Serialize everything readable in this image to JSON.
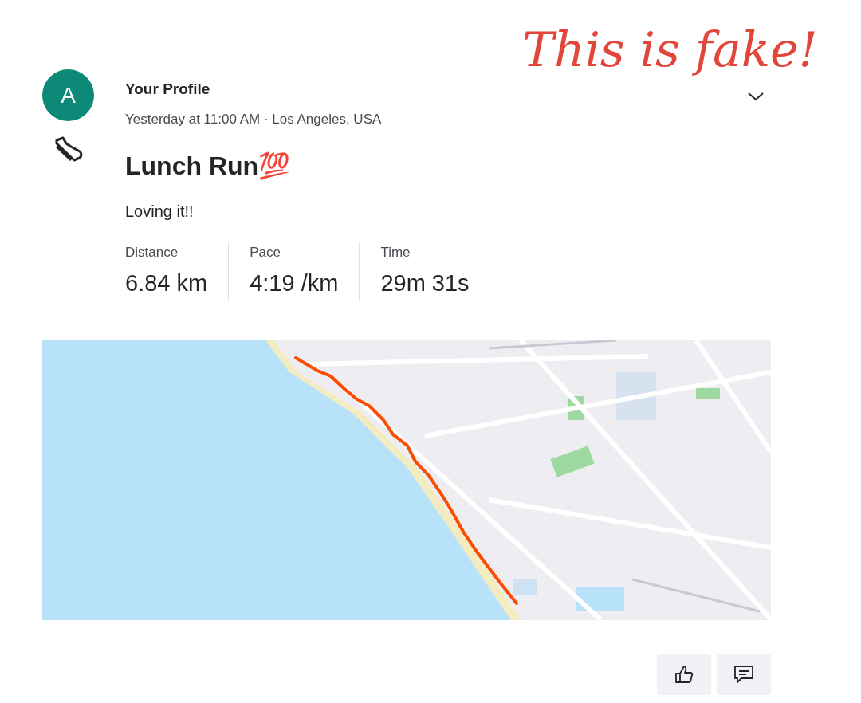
{
  "annotation": "This is fake!",
  "author": {
    "initial": "A",
    "name": "Your Profile",
    "meta": "Yesterday at 11:00 AM · Los Angeles, USA"
  },
  "activity": {
    "title": "Lunch Run💯",
    "description": "Loving it!!"
  },
  "stats": [
    {
      "label": "Distance",
      "value": "6.84 km"
    },
    {
      "label": "Pace",
      "value": "4:19 /km"
    },
    {
      "label": "Time",
      "value": "29m 31s"
    }
  ]
}
